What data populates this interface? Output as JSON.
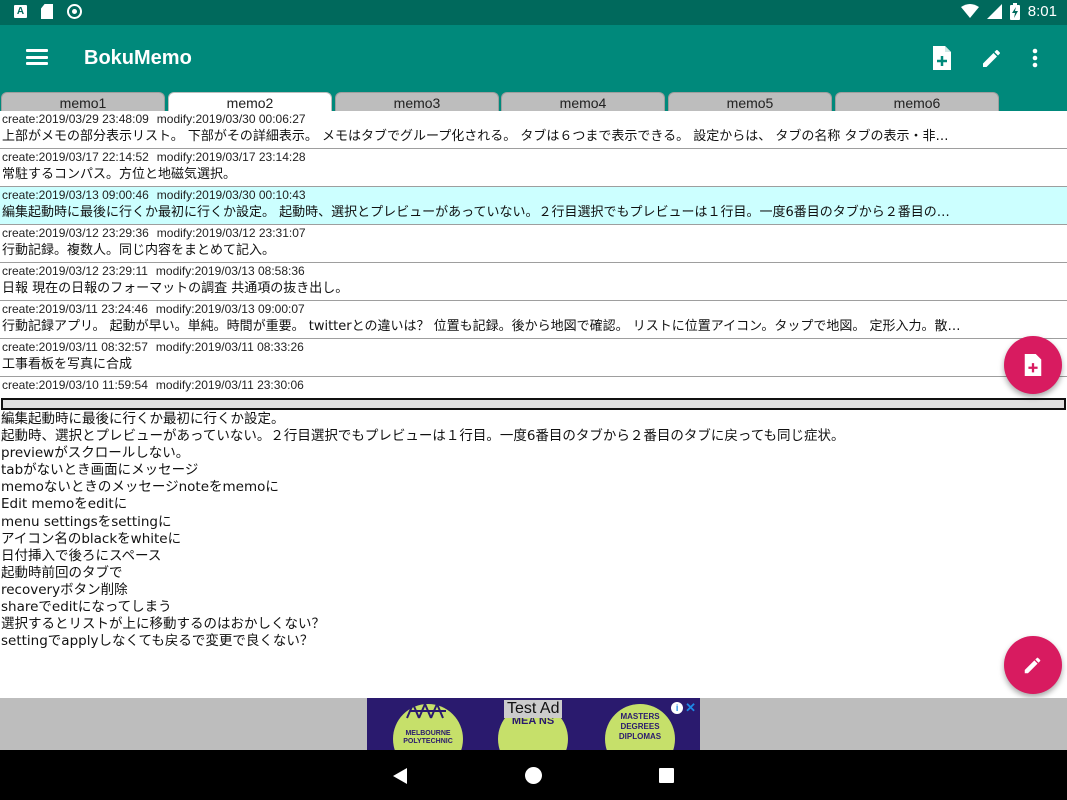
{
  "status_bar": {
    "time": "8:01",
    "icons": [
      "a-notification-icon",
      "sd-card-icon",
      "sync-circle-icon",
      "wifi-icon",
      "signal-icon",
      "battery-charging-icon"
    ]
  },
  "app_bar": {
    "title": "BokuMemo",
    "actions": [
      "add-note-icon",
      "edit-pencil-icon",
      "overflow-menu-icon"
    ],
    "color": "#00897b",
    "status_color": "#00695c"
  },
  "tabs": [
    {
      "label": "memo1",
      "active": false
    },
    {
      "label": "memo2",
      "active": true
    },
    {
      "label": "memo3",
      "active": false
    },
    {
      "label": "memo4",
      "active": false
    },
    {
      "label": "memo5",
      "active": false
    },
    {
      "label": "memo6",
      "active": false
    }
  ],
  "memos": [
    {
      "create": "create:2019/03/29 23:48:09",
      "modify": "modify:2019/03/30 00:06:27",
      "preview": "上部がメモの部分表示リスト。 下部がその詳細表示。 メモはタブでグループ化される。 タブは６つまで表示できる。 設定からは、 タブの名称 タブの表示・非…",
      "selected": false
    },
    {
      "create": "create:2019/03/17 22:14:52",
      "modify": "modify:2019/03/17 23:14:28",
      "preview": "常駐するコンパス。方位と地磁気選択。",
      "selected": false
    },
    {
      "create": "create:2019/03/13 09:00:46",
      "modify": "modify:2019/03/30 00:10:43",
      "preview": "編集起動時に最後に行くか最初に行くか設定。 起動時、選択とプレビューがあっていない。２行目選択でもプレビューは１行目。一度6番目のタブから２番目の…",
      "selected": true
    },
    {
      "create": "create:2019/03/12 23:29:36",
      "modify": "modify:2019/03/12 23:31:07",
      "preview": "行動記録。複数人。同じ内容をまとめて記入。",
      "selected": false
    },
    {
      "create": "create:2019/03/12 23:29:11",
      "modify": "modify:2019/03/13 08:58:36",
      "preview": "日報 現在の日報のフォーマットの調査 共通項の抜き出し。",
      "selected": false
    },
    {
      "create": "create:2019/03/11 23:24:46",
      "modify": "modify:2019/03/13 09:00:07",
      "preview": "行動記録アプリ。 起動が早い。単純。時間が重要。 twitterとの違いは？ 位置も記録。後から地図で確認。 リストに位置アイコン。タップで地図。 定形入力。散…",
      "selected": false
    },
    {
      "create": "create:2019/03/11 08:32:57",
      "modify": "modify:2019/03/11 08:33:26",
      "preview": "工事看板を写真に合成",
      "selected": false
    },
    {
      "create": "create:2019/03/10 11:59:54",
      "modify": "modify:2019/03/11 23:30:06",
      "preview": "",
      "selected": false
    }
  ],
  "detail_lines": [
    "編集起動時に最後に行くか最初に行くか設定。",
    "起動時、選択とプレビューがあっていない。２行目選択でもプレビューは１行目。一度6番目のタブから２番目のタブに戻っても同じ症状。",
    "previewがスクロールしない。",
    "tabがないとき画面にメッセージ",
    "memoないときのメッセージnoteをmemoに",
    "Edit memoをeditに",
    "menu settingsをsettingに",
    "アイコン名のblackをwhiteに",
    "日付挿入で後ろにスペース",
    "起動時前回のタブで",
    "recoveryボタン削除",
    "shareでeditになってしまう",
    "選択するとリストが上に移動するのはおかしくない？",
    "settingでapplyしなくても戻るで変更で良くない？"
  ],
  "fabs": {
    "add_icon": "add-note-icon",
    "edit_icon": "edit-pencil-icon",
    "color": "#d81b60"
  },
  "ad": {
    "test_label": "Test Ad",
    "left_text": "MELBOURNE\nPOLYTECHNIC",
    "center_text": "MEA NS",
    "right_text": "MASTERS\nDEGREES\nDIPLOMAS",
    "close": "✕"
  },
  "nav_bar": {
    "icons": [
      "back-icon",
      "home-icon",
      "recents-icon"
    ]
  }
}
